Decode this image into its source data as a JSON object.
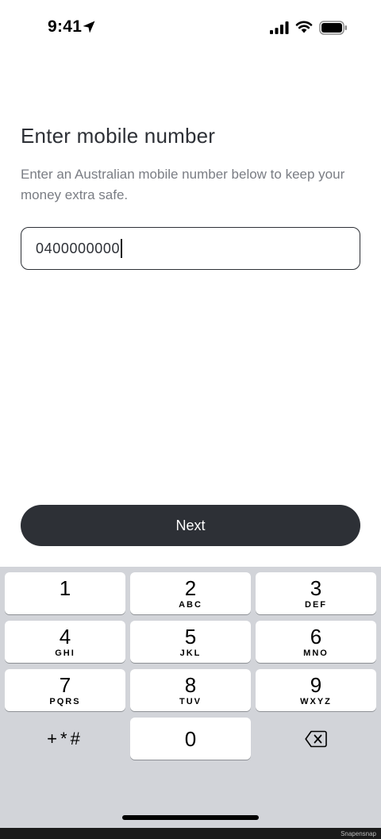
{
  "status_bar": {
    "time": "9:41"
  },
  "screen": {
    "title": "Enter mobile number",
    "description": "Enter an Australian mobile number below to keep your money extra safe."
  },
  "phone_input": {
    "value": "0400000000"
  },
  "next_button": {
    "label": "Next"
  },
  "keypad": {
    "keys": [
      {
        "digit": "1",
        "letters": ""
      },
      {
        "digit": "2",
        "letters": "ABC"
      },
      {
        "digit": "3",
        "letters": "DEF"
      },
      {
        "digit": "4",
        "letters": "GHI"
      },
      {
        "digit": "5",
        "letters": "JKL"
      },
      {
        "digit": "6",
        "letters": "MNO"
      },
      {
        "digit": "7",
        "letters": "PQRS"
      },
      {
        "digit": "8",
        "letters": "TUV"
      },
      {
        "digit": "9",
        "letters": "WXYZ"
      },
      {
        "digit": "0",
        "letters": ""
      }
    ],
    "symbols_label": "+*#",
    "delete_icon": "delete-backspace-icon"
  },
  "watermark": "Snapensnap",
  "colors": {
    "primary_button": "#2d3036",
    "keyboard_bg": "#d2d4d9",
    "description_text": "#7a7d84"
  }
}
